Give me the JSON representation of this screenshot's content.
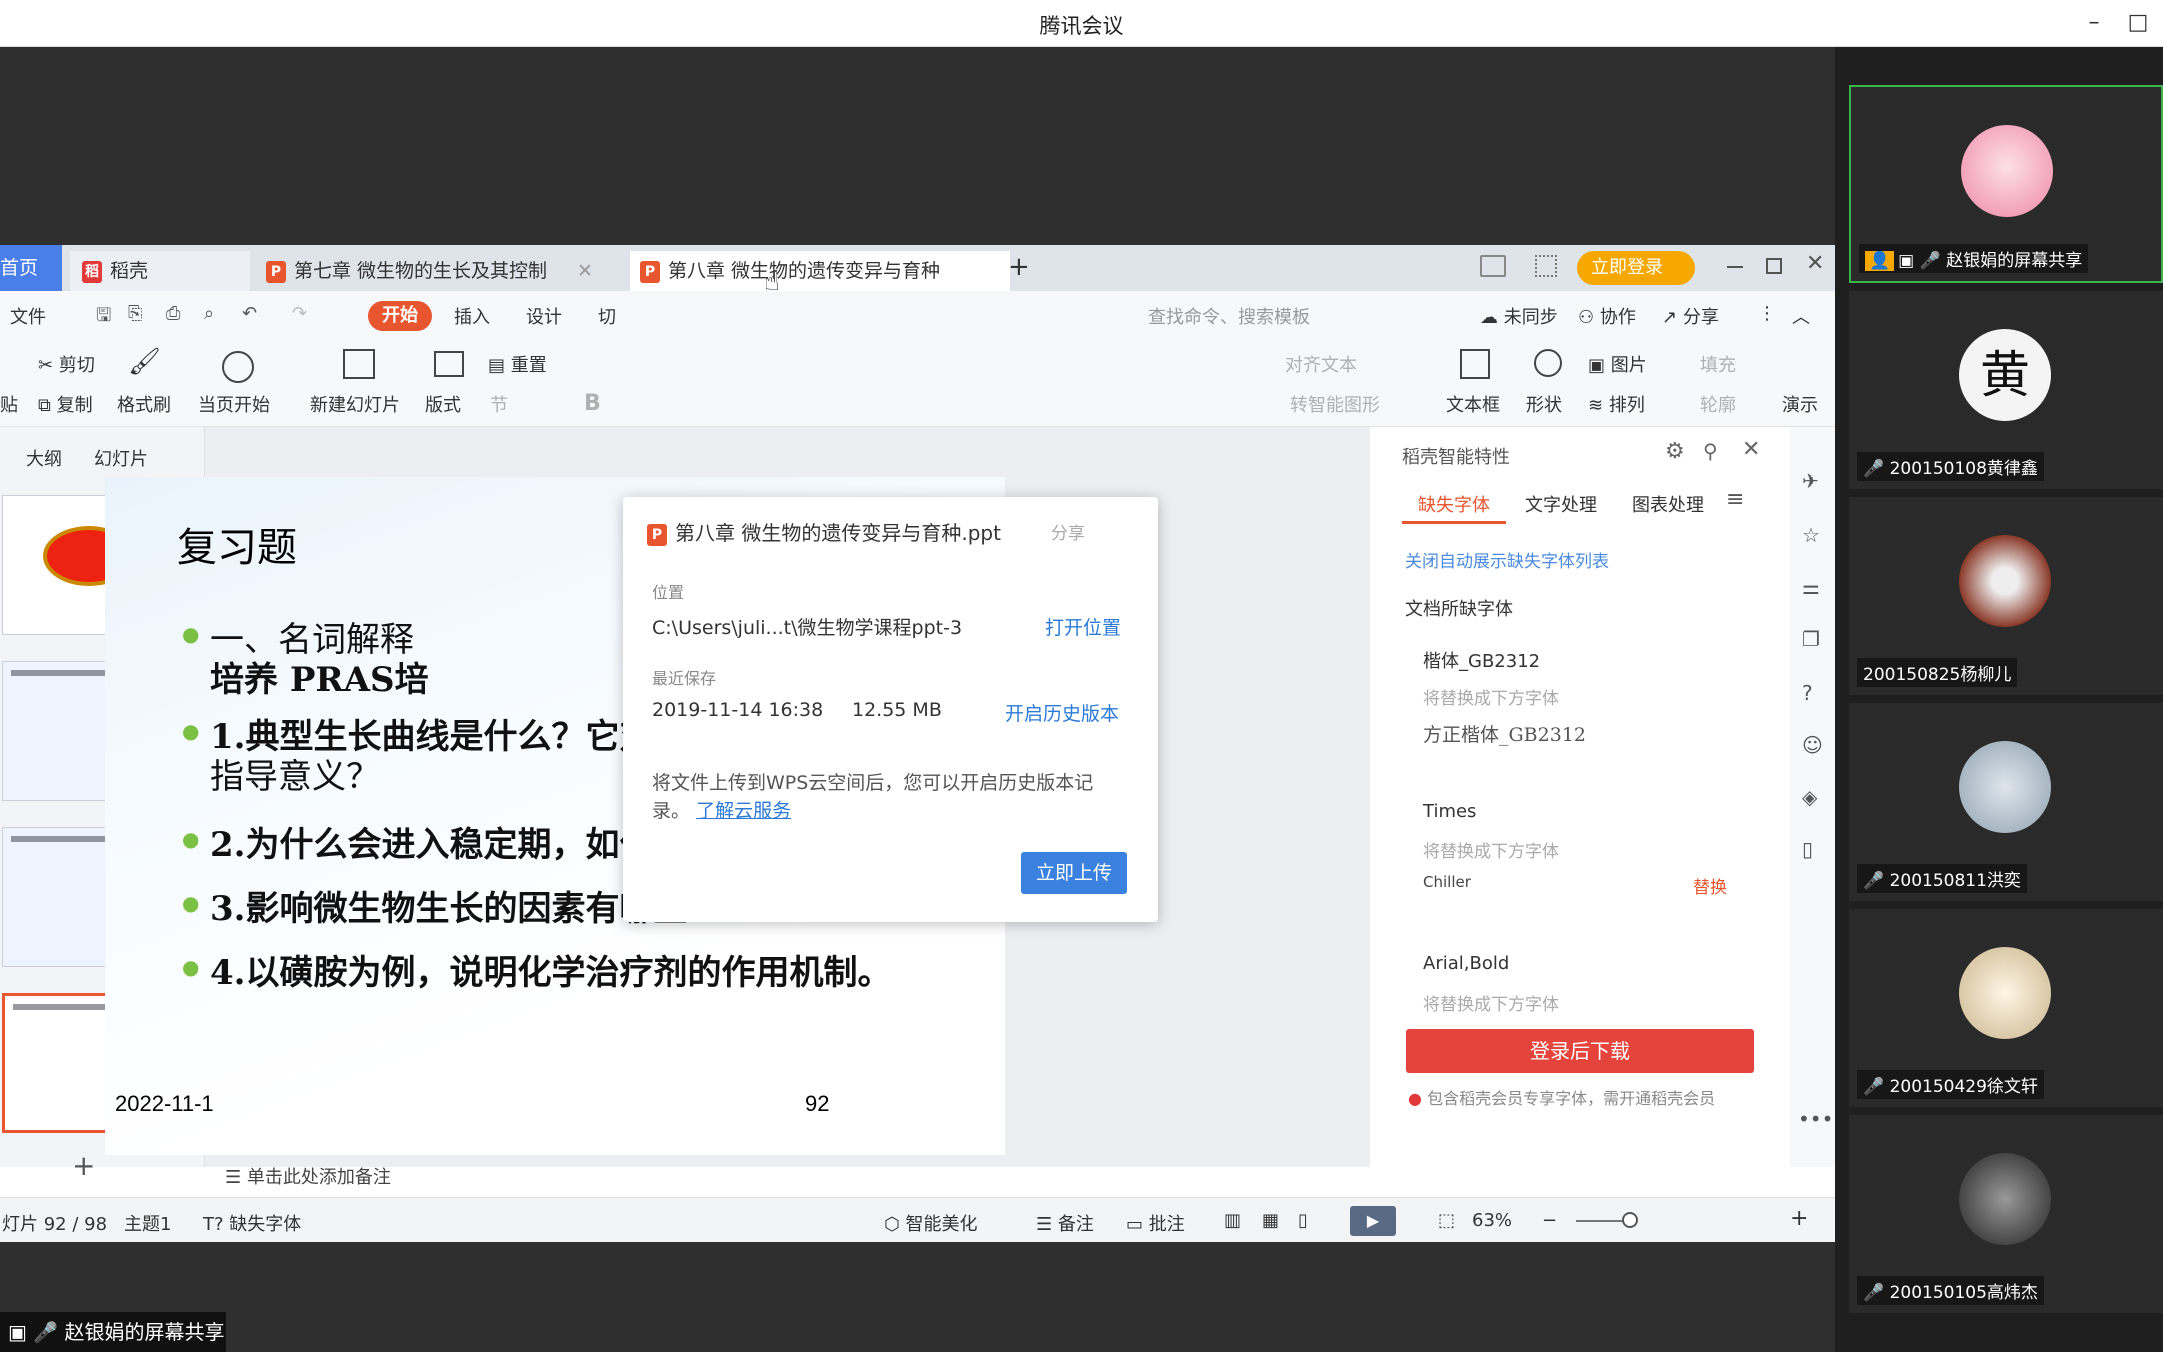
{
  "meeting": {
    "title": "腾讯会议",
    "window_controls": [
      "–",
      "□"
    ]
  },
  "wps": {
    "tabs": {
      "home": "首页",
      "daoke": "稻壳",
      "doc1": "第七章 微生物的生长及其控制",
      "doc2": "第八章 微生物的遗传变异与育种",
      "add": "+"
    },
    "top_right": {
      "login": "立即登录"
    },
    "menu": {
      "file": "文件",
      "start": "开始",
      "insert": "插入",
      "design": "设计",
      "switch": "切",
      "search": "查找命令、搜索模板",
      "unsynced": "未同步",
      "collab": "协作",
      "share": "分享"
    },
    "ribbon": {
      "paste": "贴",
      "cut": "剪切",
      "copy": "复制",
      "format_painter": "格式刷",
      "from_current": "当页开始",
      "new_slide": "新建幻灯片",
      "layout": "版式",
      "reset": "重置",
      "section": "节",
      "bold": "B",
      "textbox": "文本框",
      "shape": "形状",
      "picture": "图片",
      "arrange": "排列",
      "fill": "填充",
      "outline": "轮廓",
      "present": "演示",
      "align_text": "对齐文本",
      "smart_graphic": "转智能图形"
    },
    "thumb_tabs": {
      "outline": "大纲",
      "slides": "幻灯片"
    },
    "add_slide": "+",
    "slide": {
      "title": "复习题",
      "items": [
        "一、名词解释",
        "培养  PRAS培",
        "1.典型生长曲线是什么？它对发酵工业生产有何指导意义？",
        "2.为什么会进入稳定期，如何解决？",
        "3.影响微生物生长的因素有哪些？",
        "4.以磺胺为例，说明化学治疗剂的作用机制。"
      ],
      "line1a": "一、名词解释",
      "line1b": "培养  PRAS培",
      "item1a": "1.典型生长曲线是什么？它对发酵工业生产有何",
      "item1b": "指导意义？",
      "item2": "2.为什么会进入稳定期，如何解决？",
      "item3": "3.影响微生物生长的因素有哪些？",
      "item4": "4.以磺胺为例，说明化学治疗剂的作用机制。",
      "date": "2022-11-1",
      "page": "92"
    },
    "notes_placeholder": "单击此处添加备注",
    "popup": {
      "filename": "第八章 微生物的遗传变异与育种.ppt",
      "share": "分享",
      "location_label": "位置",
      "location": "C:\\Users\\juli...t\\微生物学课程ppt-3",
      "open_location": "打开位置",
      "saved_label": "最近保存",
      "saved_date": "2019-11-14 16:38",
      "size": "12.55 MB",
      "open_history": "开启历史版本",
      "cloud_text": "将文件上传到WPS云空间后，您可以开启历史版本记录。",
      "cloud_link": "了解云服务",
      "upload": "立即上传"
    },
    "right_panel": {
      "title": "稻壳智能特性",
      "tabs": [
        "缺失字体",
        "文字处理",
        "图表处理"
      ],
      "close_list": "关闭自动展示缺失字体列表",
      "doc_missing": "文档所缺字体",
      "fonts": [
        {
          "name": "楷体_GB2312",
          "hint": "将替换成下方字体",
          "replacement": "方正楷体_GB2312"
        },
        {
          "name": "Times",
          "hint": "将替换成下方字体",
          "replacement": "Chiller",
          "action": "替换"
        },
        {
          "name": "Arial,Bold",
          "hint": "将替换成下方字体"
        }
      ],
      "download": "登录后下载",
      "member_note": "包含稻壳会员专享字体，需开通稻壳会员"
    },
    "status": {
      "slide": "灯片 92 / 98",
      "theme": "主题1",
      "missing": "缺失字体",
      "beautify": "智能美化",
      "notes": "备注",
      "comment": "批注",
      "zoom": "63%"
    },
    "colors": {
      "accent": "#e8562f",
      "link": "#2b7bd6",
      "download": "#e5443c",
      "login": "#f7a800"
    }
  },
  "participants": [
    {
      "name": "赵银娟的屏幕共享",
      "active": true
    },
    {
      "name": "200150108黄律鑫"
    },
    {
      "name": "200150825杨柳儿"
    },
    {
      "name": "200150811洪奕"
    },
    {
      "name": "200150429徐文轩"
    },
    {
      "name": "200150105高炜杰"
    }
  ],
  "share_label": "赵银娟的屏幕共享"
}
